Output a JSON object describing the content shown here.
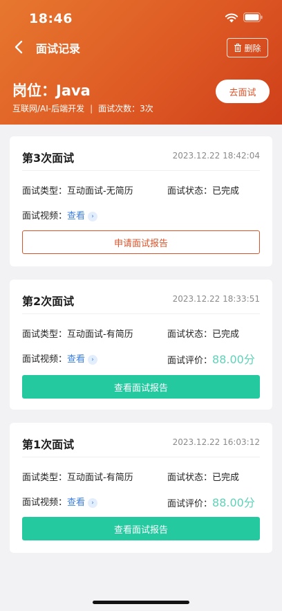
{
  "status_bar": {
    "time": "18:46"
  },
  "nav": {
    "title": "面试记录",
    "delete_label": "删除"
  },
  "post": {
    "title": "岗位：Java",
    "category": "互联网/AI-后端开发",
    "separator": "|",
    "count_text": "面试次数：3次",
    "go_label": "去面试"
  },
  "labels": {
    "type": "面试类型：",
    "status": "面试状态：",
    "video": "面试视频：",
    "score": "面试评价：",
    "view": "查看"
  },
  "records": [
    {
      "title": "第3次面试",
      "time": "2023.12.22 18:42:04",
      "type": "互动面试-无简历",
      "status": "已完成",
      "action_label": "申请面试报告"
    },
    {
      "title": "第2次面试",
      "time": "2023.12.22 18:33:51",
      "type": "互动面试-有简历",
      "status": "已完成",
      "score": "88.00分",
      "action_label": "查看面试报告"
    },
    {
      "title": "第1次面试",
      "time": "2023.12.22 16:03:12",
      "type": "互动面试-有简历",
      "status": "已完成",
      "score": "88.00分",
      "action_label": "查看面试报告"
    }
  ],
  "colors": {
    "header_start": "#e7772f",
    "header_end": "#cf3f1a",
    "accent": "#d9532a",
    "primary_button": "#24c9a0",
    "score": "#5fd2b8",
    "link": "#3b7fe0"
  }
}
